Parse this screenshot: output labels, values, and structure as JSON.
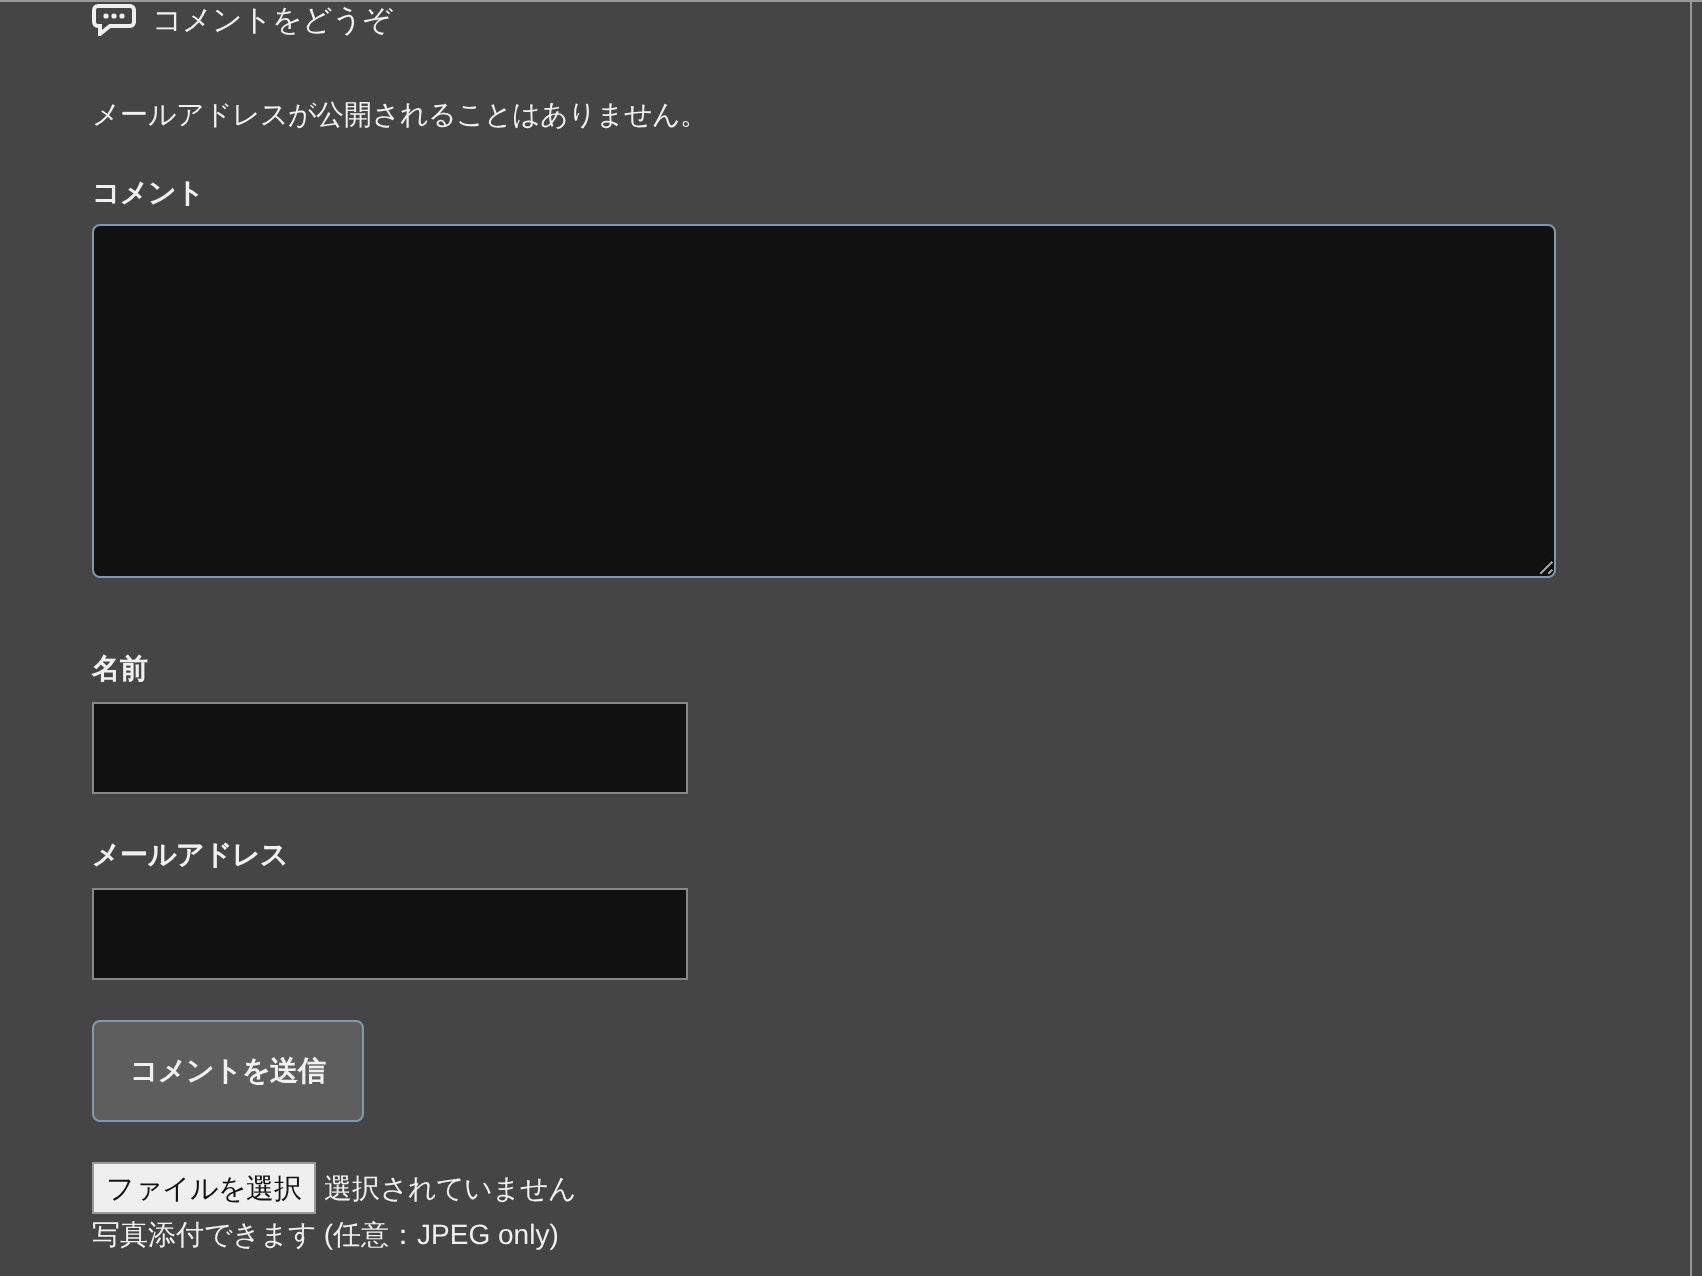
{
  "heading": "コメントをどうぞ",
  "note": "メールアドレスが公開されることはありません。",
  "comment": {
    "label": "コメント"
  },
  "fields": [
    {
      "label": "名前"
    },
    {
      "label": "メールアドレス"
    }
  ],
  "submit": "コメントを送信",
  "file": {
    "button": "ファイルを選択",
    "status": "選択されていません"
  },
  "hint": "写真添付できます (任意：JPEG only)"
}
